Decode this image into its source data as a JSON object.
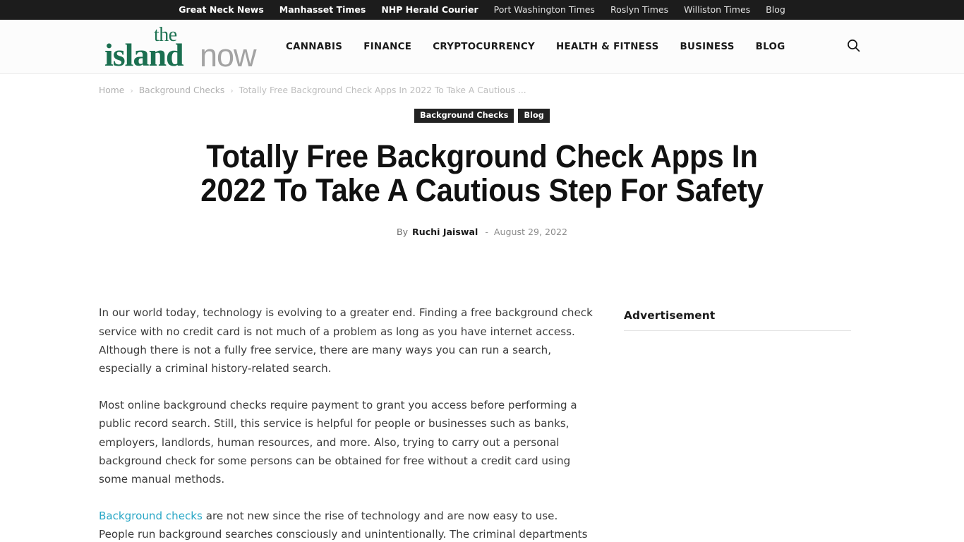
{
  "topbar": {
    "links": [
      {
        "label": "Great Neck News",
        "emphasis": "strong"
      },
      {
        "label": "Manhasset Times",
        "emphasis": "strong"
      },
      {
        "label": "NHP Herald Courier",
        "emphasis": "strong"
      },
      {
        "label": "Port Washington Times",
        "emphasis": "light"
      },
      {
        "label": "Roslyn Times",
        "emphasis": "light"
      },
      {
        "label": "Williston Times",
        "emphasis": "light"
      },
      {
        "label": "Blog",
        "emphasis": "light"
      }
    ]
  },
  "header": {
    "logo": {
      "the": "the",
      "island": "island",
      "now": "now",
      "green": "#1b6f50",
      "gray": "#a3a3a3"
    },
    "nav": [
      "CANNABIS",
      "FINANCE",
      "CRYPTOCURRENCY",
      "HEALTH & FITNESS",
      "BUSINESS",
      "BLOG"
    ],
    "search_icon": "search-icon"
  },
  "breadcrumb": {
    "items": [
      "Home",
      "Background Checks",
      "Totally Free Background Check Apps In 2022 To Take A Cautious ..."
    ],
    "separator": "›"
  },
  "article": {
    "badges": [
      "Background Checks",
      "Blog"
    ],
    "title": "Totally Free Background Check Apps In 2022 To Take A Cautious Step For Safety",
    "byline": {
      "by_label": "By",
      "author": "Ruchi Jaiswal",
      "dash": "-",
      "date": "August 29, 2022"
    },
    "paragraphs": [
      "In our world today, technology is evolving to a greater end. Finding a free background check service with no credit card is not much of a problem as long as you have internet access. Although there is not a fully free service, there are many ways you can run a search, especially a criminal history-related search.",
      "Most online background checks require payment to grant you access before performing a public record search. Still, this service is helpful for people or businesses such as banks, employers, landlords, human resources, and more. Also, trying to carry out a personal background check for some persons can be obtained for free without a credit card using some manual methods."
    ],
    "paragraph3": {
      "link_text": "Background checks",
      "rest": " are not new since the rise of technology and are now easy to use. People run background searches consciously and unintentionally. The criminal departments",
      "link_color": "#29a7c6"
    }
  },
  "sidebar": {
    "ad_label": "Advertisement"
  }
}
